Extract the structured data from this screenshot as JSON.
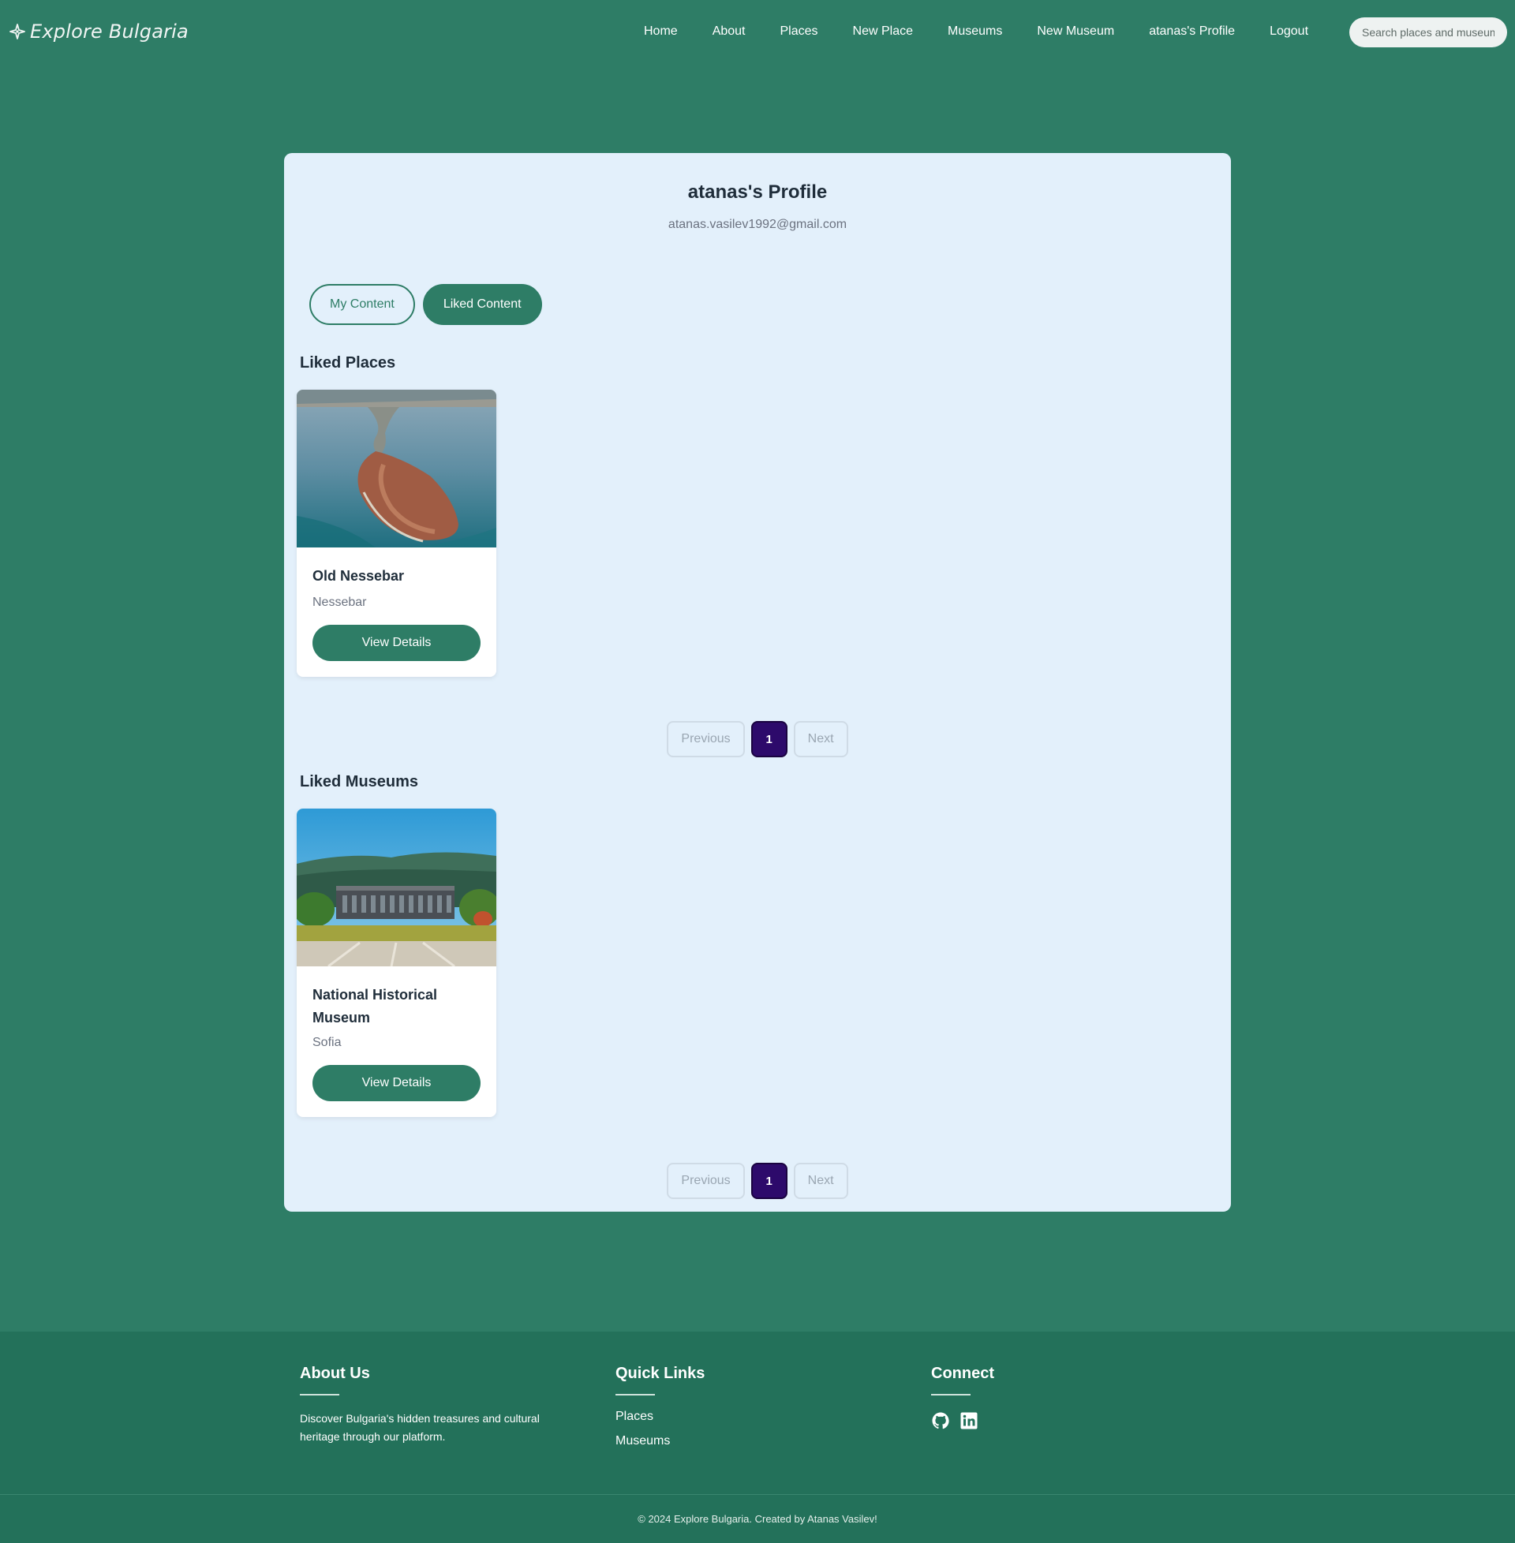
{
  "brand": {
    "name": "Explore Bulgaria",
    "icon": "compass-icon"
  },
  "nav": {
    "items": [
      {
        "label": "Home"
      },
      {
        "label": "About"
      },
      {
        "label": "Places"
      },
      {
        "label": "New Place"
      },
      {
        "label": "Museums"
      },
      {
        "label": "New Museum"
      },
      {
        "label": "atanas's Profile"
      },
      {
        "label": "Logout"
      }
    ],
    "search_placeholder": "Search places and museums"
  },
  "profile": {
    "title": "atanas's Profile",
    "email": "atanas.vasilev1992@gmail.com",
    "tabs": [
      {
        "label": "My Content",
        "active": false
      },
      {
        "label": "Liked Content",
        "active": true
      }
    ]
  },
  "liked_places": {
    "heading": "Liked Places",
    "items": [
      {
        "title": "Old Nessebar",
        "location": "Nessebar",
        "button": "View Details"
      }
    ],
    "pagination": {
      "prev": "Previous",
      "current": "1",
      "next": "Next"
    }
  },
  "liked_museums": {
    "heading": "Liked Museums",
    "items": [
      {
        "title": "National Historical Museum",
        "location": "Sofia",
        "button": "View Details"
      }
    ],
    "pagination": {
      "prev": "Previous",
      "current": "1",
      "next": "Next"
    }
  },
  "footer": {
    "about": {
      "heading": "About Us",
      "text": "Discover Bulgaria's hidden treasures and cultural heritage through our platform."
    },
    "quick_links": {
      "heading": "Quick Links",
      "links": [
        {
          "label": "Places"
        },
        {
          "label": "Museums"
        }
      ]
    },
    "connect": {
      "heading": "Connect",
      "icons": [
        "github-icon",
        "linkedin-icon"
      ]
    },
    "copyright": "© 2024 Explore Bulgaria. Created by Atanas Vasilev!"
  },
  "colors": {
    "primary": "#2e7d66",
    "footer": "#23715a",
    "card_bg": "#e3f0fb",
    "pager_active": "#2d0a6b"
  }
}
